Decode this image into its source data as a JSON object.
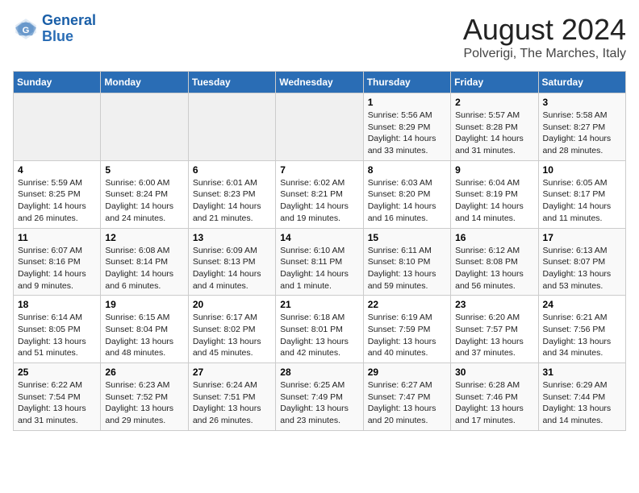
{
  "logo": {
    "line1": "General",
    "line2": "Blue"
  },
  "title": "August 2024",
  "subtitle": "Polverigi, The Marches, Italy",
  "days_of_week": [
    "Sunday",
    "Monday",
    "Tuesday",
    "Wednesday",
    "Thursday",
    "Friday",
    "Saturday"
  ],
  "weeks": [
    [
      {
        "day": "",
        "info": ""
      },
      {
        "day": "",
        "info": ""
      },
      {
        "day": "",
        "info": ""
      },
      {
        "day": "",
        "info": ""
      },
      {
        "day": "1",
        "info": "Sunrise: 5:56 AM\nSunset: 8:29 PM\nDaylight: 14 hours\nand 33 minutes."
      },
      {
        "day": "2",
        "info": "Sunrise: 5:57 AM\nSunset: 8:28 PM\nDaylight: 14 hours\nand 31 minutes."
      },
      {
        "day": "3",
        "info": "Sunrise: 5:58 AM\nSunset: 8:27 PM\nDaylight: 14 hours\nand 28 minutes."
      }
    ],
    [
      {
        "day": "4",
        "info": "Sunrise: 5:59 AM\nSunset: 8:25 PM\nDaylight: 14 hours\nand 26 minutes."
      },
      {
        "day": "5",
        "info": "Sunrise: 6:00 AM\nSunset: 8:24 PM\nDaylight: 14 hours\nand 24 minutes."
      },
      {
        "day": "6",
        "info": "Sunrise: 6:01 AM\nSunset: 8:23 PM\nDaylight: 14 hours\nand 21 minutes."
      },
      {
        "day": "7",
        "info": "Sunrise: 6:02 AM\nSunset: 8:21 PM\nDaylight: 14 hours\nand 19 minutes."
      },
      {
        "day": "8",
        "info": "Sunrise: 6:03 AM\nSunset: 8:20 PM\nDaylight: 14 hours\nand 16 minutes."
      },
      {
        "day": "9",
        "info": "Sunrise: 6:04 AM\nSunset: 8:19 PM\nDaylight: 14 hours\nand 14 minutes."
      },
      {
        "day": "10",
        "info": "Sunrise: 6:05 AM\nSunset: 8:17 PM\nDaylight: 14 hours\nand 11 minutes."
      }
    ],
    [
      {
        "day": "11",
        "info": "Sunrise: 6:07 AM\nSunset: 8:16 PM\nDaylight: 14 hours\nand 9 minutes."
      },
      {
        "day": "12",
        "info": "Sunrise: 6:08 AM\nSunset: 8:14 PM\nDaylight: 14 hours\nand 6 minutes."
      },
      {
        "day": "13",
        "info": "Sunrise: 6:09 AM\nSunset: 8:13 PM\nDaylight: 14 hours\nand 4 minutes."
      },
      {
        "day": "14",
        "info": "Sunrise: 6:10 AM\nSunset: 8:11 PM\nDaylight: 14 hours\nand 1 minute."
      },
      {
        "day": "15",
        "info": "Sunrise: 6:11 AM\nSunset: 8:10 PM\nDaylight: 13 hours\nand 59 minutes."
      },
      {
        "day": "16",
        "info": "Sunrise: 6:12 AM\nSunset: 8:08 PM\nDaylight: 13 hours\nand 56 minutes."
      },
      {
        "day": "17",
        "info": "Sunrise: 6:13 AM\nSunset: 8:07 PM\nDaylight: 13 hours\nand 53 minutes."
      }
    ],
    [
      {
        "day": "18",
        "info": "Sunrise: 6:14 AM\nSunset: 8:05 PM\nDaylight: 13 hours\nand 51 minutes."
      },
      {
        "day": "19",
        "info": "Sunrise: 6:15 AM\nSunset: 8:04 PM\nDaylight: 13 hours\nand 48 minutes."
      },
      {
        "day": "20",
        "info": "Sunrise: 6:17 AM\nSunset: 8:02 PM\nDaylight: 13 hours\nand 45 minutes."
      },
      {
        "day": "21",
        "info": "Sunrise: 6:18 AM\nSunset: 8:01 PM\nDaylight: 13 hours\nand 42 minutes."
      },
      {
        "day": "22",
        "info": "Sunrise: 6:19 AM\nSunset: 7:59 PM\nDaylight: 13 hours\nand 40 minutes."
      },
      {
        "day": "23",
        "info": "Sunrise: 6:20 AM\nSunset: 7:57 PM\nDaylight: 13 hours\nand 37 minutes."
      },
      {
        "day": "24",
        "info": "Sunrise: 6:21 AM\nSunset: 7:56 PM\nDaylight: 13 hours\nand 34 minutes."
      }
    ],
    [
      {
        "day": "25",
        "info": "Sunrise: 6:22 AM\nSunset: 7:54 PM\nDaylight: 13 hours\nand 31 minutes."
      },
      {
        "day": "26",
        "info": "Sunrise: 6:23 AM\nSunset: 7:52 PM\nDaylight: 13 hours\nand 29 minutes."
      },
      {
        "day": "27",
        "info": "Sunrise: 6:24 AM\nSunset: 7:51 PM\nDaylight: 13 hours\nand 26 minutes."
      },
      {
        "day": "28",
        "info": "Sunrise: 6:25 AM\nSunset: 7:49 PM\nDaylight: 13 hours\nand 23 minutes."
      },
      {
        "day": "29",
        "info": "Sunrise: 6:27 AM\nSunset: 7:47 PM\nDaylight: 13 hours\nand 20 minutes."
      },
      {
        "day": "30",
        "info": "Sunrise: 6:28 AM\nSunset: 7:46 PM\nDaylight: 13 hours\nand 17 minutes."
      },
      {
        "day": "31",
        "info": "Sunrise: 6:29 AM\nSunset: 7:44 PM\nDaylight: 13 hours\nand 14 minutes."
      }
    ]
  ]
}
